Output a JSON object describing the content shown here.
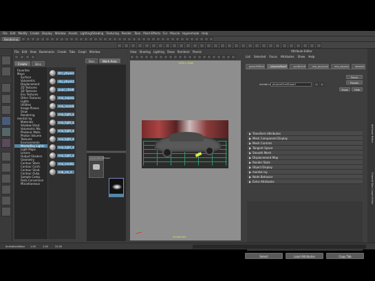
{
  "statusline": {
    "mode": "Rendering"
  },
  "menubar": {
    "items": [
      "File",
      "Edit",
      "Modify",
      "Create",
      "Display",
      "Window",
      "Assets",
      "Lighting/Shading",
      "Texturing",
      "Render",
      "Toon",
      "Paint Effects",
      "Fur",
      "Muscle",
      "Hypershade",
      "Help"
    ]
  },
  "hypershade": {
    "menus": [
      "File",
      "Edit",
      "View",
      "Bookmarks",
      "Create",
      "Tabs",
      "Graph",
      "Window"
    ],
    "create_tab": "Create",
    "bins_tab": "Bins",
    "tree_items": [
      {
        "label": "Favorites",
        "group": true
      },
      {
        "label": "Maya",
        "group": true
      },
      {
        "label": "Surface",
        "group": false
      },
      {
        "label": "Volumetric",
        "group": false
      },
      {
        "label": "Displacement",
        "group": false
      },
      {
        "label": "2D Textures",
        "group": false
      },
      {
        "label": "3D Textures",
        "group": false
      },
      {
        "label": "Env Textures",
        "group": false
      },
      {
        "label": "Other Textures",
        "group": false
      },
      {
        "label": "Lights",
        "group": false
      },
      {
        "label": "Utilities",
        "group": false
      },
      {
        "label": "Image Planes",
        "group": false
      },
      {
        "label": "Glow",
        "group": false
      },
      {
        "label": "Rendering",
        "group": false
      },
      {
        "label": "mental ray",
        "group": true
      },
      {
        "label": "Materials",
        "group": false
      },
      {
        "label": "Shadow Shad.",
        "group": false
      },
      {
        "label": "Volumetric Ma.",
        "group": false
      },
      {
        "label": "Photonic Mate.",
        "group": false
      },
      {
        "label": "Photon Volume",
        "group": false
      },
      {
        "label": "Textures",
        "group": false
      },
      {
        "label": "Environments",
        "group": false
      },
      {
        "label": "MentalRay Lights",
        "group": false,
        "selected": true
      },
      {
        "label": "Light Maps",
        "group": false
      },
      {
        "label": "Lenses",
        "group": false
      },
      {
        "label": "Output Shaders",
        "group": false
      },
      {
        "label": "Geometry",
        "group": false
      },
      {
        "label": "Contour Store",
        "group": false
      },
      {
        "label": "Contour Contr.",
        "group": false
      },
      {
        "label": "Contour Shad.",
        "group": false
      },
      {
        "label": "Contour Outp.",
        "group": false
      },
      {
        "label": "Sample Comp.",
        "group": false
      },
      {
        "label": "Data Conversion",
        "group": false
      },
      {
        "label": "Miscellaneous",
        "group": false
      }
    ],
    "swatches": [
      "bhr_physical",
      "sky_physical",
      "pupc_shader",
      "mia_exposure",
      "mia_roundcorn.",
      "mia_light_surf.",
      "mia_light_sur.",
      "mia_light_sh.",
      "mia_light_sh.",
      "mia_light_sh.",
      "mia_light_sh.",
      "mia_envblur",
      "mib_cie_d"
    ],
    "bins_label": "Bins",
    "work_label": "Work Area"
  },
  "panel": {
    "menus": [
      "View",
      "Shading",
      "Lighting",
      "Show",
      "Renderer",
      "Panels"
    ],
    "top_label": "1920 x 1080",
    "bottom_label": "renderCam"
  },
  "attr_editor": {
    "title": "Attribute Editor",
    "menus": [
      "List",
      "Selected",
      "Focus",
      "Attributes",
      "Show",
      "Help"
    ],
    "tabs": [
      "place3dTexture1",
      "physicalSunShape1",
      "sunDirection",
      "mia_physicalsky1",
      "mia_exposure1",
      "lambert1"
    ],
    "active_tab": 1,
    "focus_btn": "Focus",
    "presets_btn": "Presets",
    "show_btn": "Show",
    "hide_btn": "Hide",
    "field_label": "mental ray",
    "field_value": "physicalSunShape1",
    "sections": [
      "Transform Attributes",
      "Mesh Component Display",
      "Mesh Controls",
      "Tangent Space",
      "Smooth Mesh",
      "Displacement Map",
      "Render Stats",
      "Object Display",
      "mental ray",
      "Node Behavior",
      "Extra Attributes"
    ],
    "btn_select": "Select",
    "btn_load": "Load Attributes",
    "btn_copy": "Copy Tab"
  },
  "side_strip": {
    "label1": "Attribute Editor",
    "label2": "Channel Box / Layer Editor"
  },
  "timeline": {
    "frame": "1.00",
    "range_start": "1.00",
    "range_end": "24.00",
    "mode": "Animation/Move"
  },
  "colors": {
    "bg": "#3c3c3c",
    "selection": "#5285a6",
    "viewport": "#8c8c8c",
    "grid": "#2aa46a"
  }
}
